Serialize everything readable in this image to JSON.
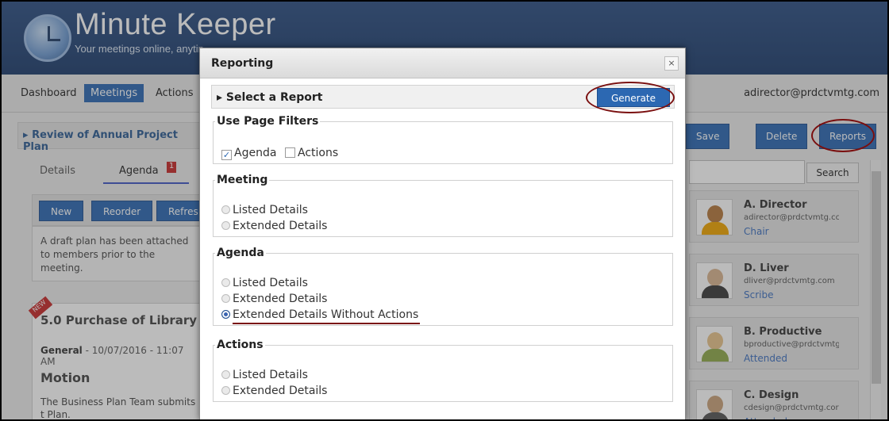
{
  "app": {
    "name": "Minute Keeper",
    "tagline": "Your meetings online, anytin"
  },
  "nav": {
    "items": [
      {
        "label": "Dashboard"
      },
      {
        "label": "Meetings"
      },
      {
        "label": "Actions"
      }
    ],
    "user": "adirector@prdctvmtg.com"
  },
  "meeting": {
    "title": "Review of Annual Project Plan",
    "tabs": [
      {
        "label": "Details"
      },
      {
        "label": "Agenda"
      }
    ],
    "agenda_badge": "1",
    "buttons": [
      "New",
      "Reorder",
      "Refres"
    ],
    "draft_text": "A draft plan has been attached to members prior to the meeting.",
    "item": {
      "new_badge": "NEW",
      "title": "5.0  Purchase of Library R",
      "category": "General",
      "datetime": " - 10/07/2016 - 11:07 AM",
      "motion_label": "Motion",
      "motion_text": "The Business Plan Team submits t Plan."
    }
  },
  "right": {
    "buttons": [
      "Save",
      "Delete",
      "Reports"
    ],
    "search_label": "Search",
    "people": [
      {
        "name": "A. Director",
        "email": "adirector@prdctvmtg.cc",
        "role": "Chair"
      },
      {
        "name": "D. Liver",
        "email": "dliver@prdctvmtg.com",
        "role": "Scribe"
      },
      {
        "name": "B. Productive",
        "email": "bproductive@prdctvmtg",
        "role": "Attended"
      },
      {
        "name": "C. Design",
        "email": "cdesign@prdctvmtg.cor",
        "role": "Attended"
      }
    ]
  },
  "modal": {
    "title": "Reporting",
    "close_glyph": "×",
    "select_label": "Select a Report",
    "generate_label": "Generate",
    "page_filters": {
      "legend": "Use Page Filters",
      "agenda": "Agenda",
      "actions": "Actions"
    },
    "meeting": {
      "legend": "Meeting",
      "options": [
        "Listed Details",
        "Extended Details"
      ]
    },
    "agenda": {
      "legend": "Agenda",
      "options": [
        "Listed Details",
        "Extended Details",
        "Extended Details Without Actions"
      ]
    },
    "actions": {
      "legend": "Actions",
      "options": [
        "Listed Details",
        "Extended Details"
      ]
    }
  },
  "colors": {
    "accent": "#2c68b2",
    "header": "#1d3c6c",
    "highlight_ring": "#7a0f0f"
  }
}
